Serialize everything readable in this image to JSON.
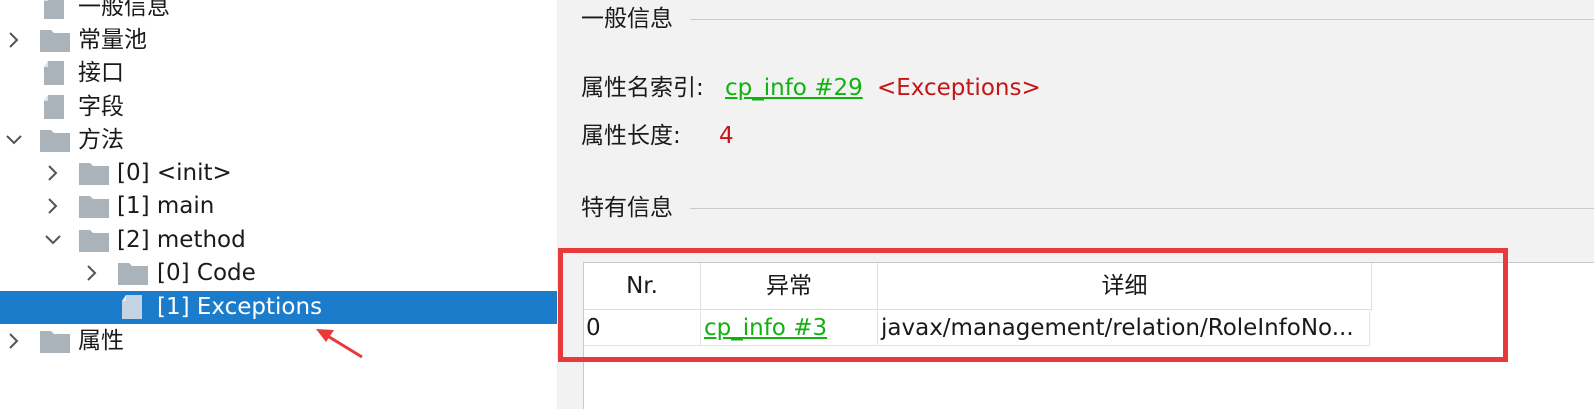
{
  "tree": {
    "items": [
      {
        "label": "一般信息"
      },
      {
        "label": "常量池"
      },
      {
        "label": "接口"
      },
      {
        "label": "字段"
      },
      {
        "label": "方法"
      },
      {
        "label": "[0] <init>"
      },
      {
        "label": "[1] main"
      },
      {
        "label": "[2] method"
      },
      {
        "label": "[0] Code"
      },
      {
        "label": "[1] Exceptions"
      },
      {
        "label": "属性"
      }
    ],
    "selected_label": "[1] Exceptions"
  },
  "general": {
    "title": "一般信息",
    "name_index_label": "属性名索引:",
    "name_index_link": "cp_info #29",
    "name_index_note": "<Exceptions>",
    "length_label": "属性长度:",
    "length_value": "4"
  },
  "specific": {
    "title": "特有信息",
    "table": {
      "headers": [
        "Nr.",
        "异常",
        "详细"
      ],
      "rows": [
        {
          "nr": "0",
          "exception": "cp_info #3",
          "detail": "javax/management/relation/RoleInfoNo..."
        }
      ]
    }
  },
  "colors": {
    "selection": "#1b7ccc",
    "link": "#11b111",
    "value": "#c81414",
    "annotation": "#e83a3a"
  },
  "icons": {
    "folder": "folder-icon",
    "file": "file-icon",
    "expand": "chevron-right-icon",
    "collapse": "chevron-down-icon"
  }
}
